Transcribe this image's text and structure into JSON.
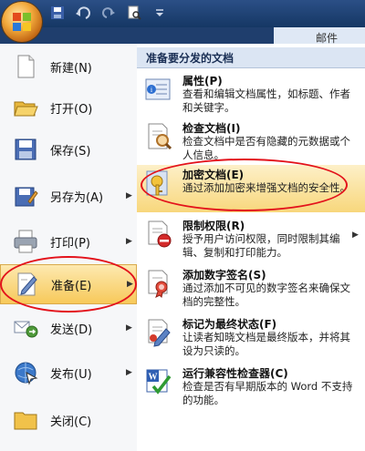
{
  "quick_access": {
    "icons": [
      "save-icon",
      "undo-icon",
      "redo-icon",
      "print-preview-icon",
      "customize-icon"
    ]
  },
  "ribbon": {
    "tab_mail": "邮件"
  },
  "left_menu": {
    "items": [
      {
        "label": "新建(N)",
        "icon": "new-document-icon"
      },
      {
        "label": "打开(O)",
        "icon": "open-folder-icon"
      },
      {
        "label": "保存(S)",
        "icon": "save-disk-icon"
      },
      {
        "label": "另存为(A)",
        "icon": "save-as-icon",
        "has_submenu": true
      },
      {
        "label": "打印(P)",
        "icon": "printer-icon",
        "has_submenu": true
      },
      {
        "label": "准备(E)",
        "icon": "prepare-icon",
        "has_submenu": true,
        "selected": true
      },
      {
        "label": "发送(D)",
        "icon": "send-icon",
        "has_submenu": true
      },
      {
        "label": "发布(U)",
        "icon": "publish-icon",
        "has_submenu": true
      },
      {
        "label": "关闭(C)",
        "icon": "close-folder-icon"
      }
    ]
  },
  "submenu": {
    "header": "准备要分发的文档",
    "items": [
      {
        "title": "属性(P)",
        "desc": "查看和编辑文档属性，如标题、作者和关键字。",
        "icon": "properties-icon"
      },
      {
        "title": "检查文档(I)",
        "desc": "检查文档中是否有隐藏的元数据或个人信息。",
        "icon": "inspect-document-icon"
      },
      {
        "title": "加密文档(E)",
        "desc": "通过添加加密来增强文档的安全性。",
        "icon": "encrypt-key-icon",
        "highlighted": true
      },
      {
        "title": "限制权限(R)",
        "desc": "授予用户访问权限，同时限制其编辑、复制和打印能力。",
        "icon": "restrict-permission-icon",
        "has_submenu": true
      },
      {
        "title": "添加数字签名(S)",
        "desc": "通过添加不可见的数字签名来确保文档的完整性。",
        "icon": "digital-signature-icon"
      },
      {
        "title": "标记为最终状态(F)",
        "desc": "让读者知晓文档是最终版本，并将其设为只读的。",
        "icon": "mark-final-icon"
      },
      {
        "title": "运行兼容性检查器(C)",
        "desc": "检查是否有早期版本的 Word 不支持的功能。",
        "icon": "compatibility-checker-icon"
      }
    ]
  }
}
